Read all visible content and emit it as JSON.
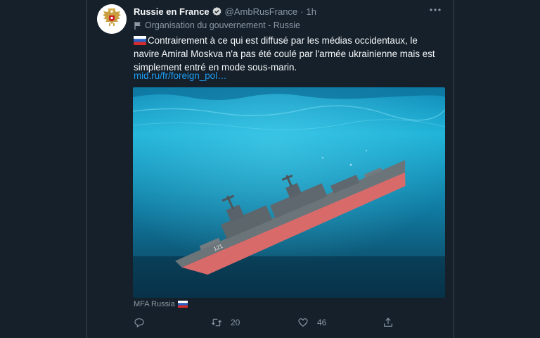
{
  "colors": {
    "background": "#15202b",
    "text_primary": "#f7f9f9",
    "text_secondary": "#8b98a5",
    "link": "#1d9bf0",
    "verified": "#d9d9d9",
    "hull_red": "#d96a6a",
    "hull_gray": "#6b7478",
    "water_top": "#1fb3d8",
    "water_bottom": "#0a3952"
  },
  "tweet": {
    "author_name": "Russie en France",
    "author_handle": "@AmbRusFrance",
    "separator": "·",
    "timestamp": "1h",
    "account_label": "Organisation du gouvernement - Russie",
    "text": "Contrairement à ce qui est diffusé par les médias occidentaux, le navire Amiral Moskva n'a pas été coulé par l'armée ukrainienne mais est simplement entré en mode sous-marin.",
    "link_text": "mid.ru/fr/foreign_pol…",
    "media_credit": "MFA Russia",
    "ship_hull_number": "121",
    "icons": {
      "avatar": "russian-coat-of-arms-icon",
      "verified": "verified-badge-icon",
      "more": "more-icon",
      "label": "flag-icon",
      "inline_flag": "russian-flag-icon",
      "reply": "reply-icon",
      "retweet": "retweet-icon",
      "like": "heart-icon",
      "share": "share-icon"
    }
  },
  "actions": {
    "reply_count": "",
    "retweet_count": "20",
    "like_count": "46"
  }
}
